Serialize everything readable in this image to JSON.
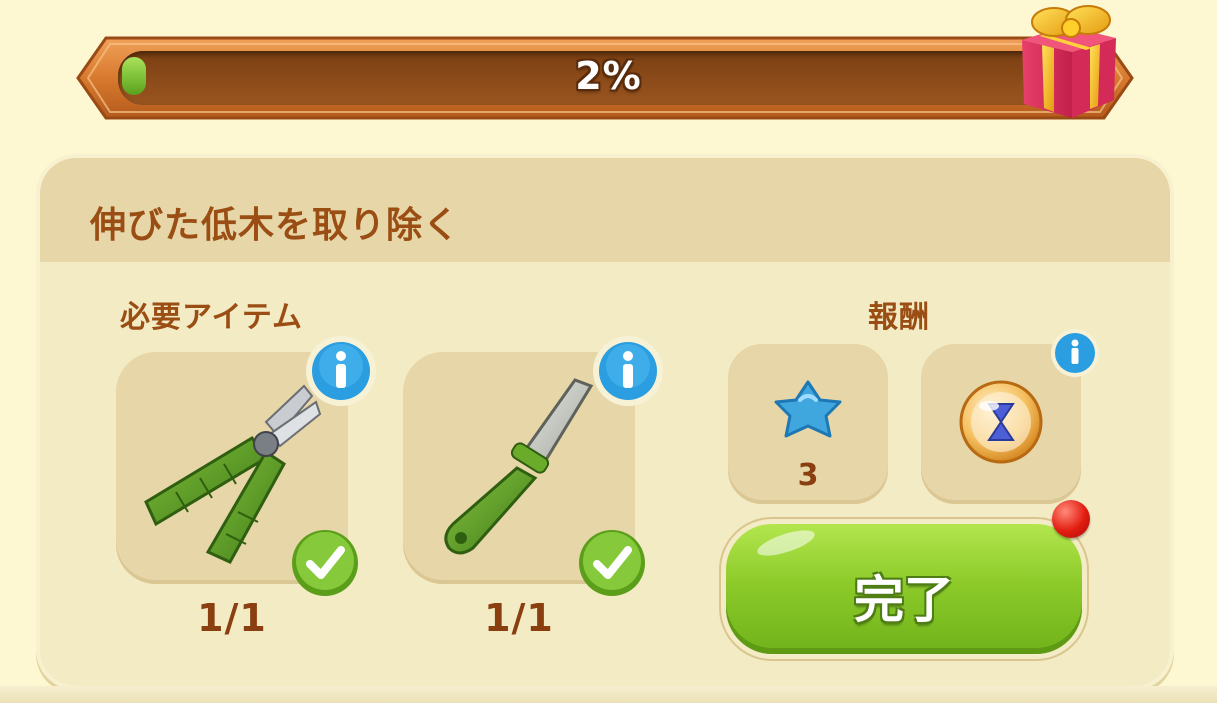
{
  "progress": {
    "value": 0.02,
    "label": "2%"
  },
  "quest": {
    "title": "伸びた低木を取り除く",
    "required_label": "必要アイテム",
    "reward_label": "報酬",
    "items": [
      {
        "name": "pruning-shears",
        "count": "1/1",
        "complete": true
      },
      {
        "name": "knife",
        "count": "1/1",
        "complete": true
      }
    ],
    "rewards": [
      {
        "name": "blue-star",
        "count": "3"
      },
      {
        "name": "hourglass-booster",
        "count": ""
      }
    ],
    "complete_button": "完了"
  },
  "colors": {
    "accent_green": "#8dcb2a",
    "title_brown": "#9a4e14",
    "panel": "#f3ebc4"
  }
}
